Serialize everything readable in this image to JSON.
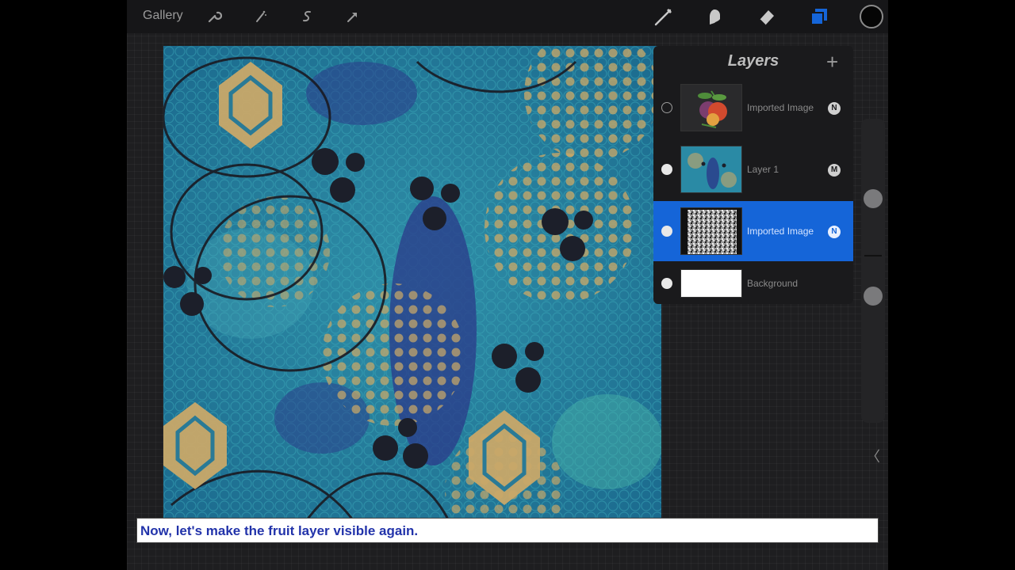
{
  "toolbar": {
    "gallery_label": "Gallery",
    "left_tools": [
      "wrench-icon",
      "magic-wand-icon",
      "selection-icon",
      "transform-icon"
    ],
    "right_tools": [
      "brush-icon",
      "smudge-icon",
      "eraser-icon",
      "layers-icon"
    ],
    "active_tool": "layers-icon",
    "accent_color": "#1565d8",
    "current_color": "#050505"
  },
  "layers_panel": {
    "title": "Layers",
    "add_label": "+",
    "layers": [
      {
        "name": "Imported Image",
        "visible": false,
        "selected": false,
        "blend": "N",
        "thumb": "fruit"
      },
      {
        "name": "Layer 1",
        "visible": true,
        "selected": false,
        "blend": "M",
        "thumb": "texture"
      },
      {
        "name": "Imported Image",
        "visible": true,
        "selected": true,
        "blend": "N",
        "thumb": "noise"
      },
      {
        "name": "Background",
        "visible": true,
        "selected": false,
        "blend": "",
        "thumb": "white"
      }
    ]
  },
  "sidebar": {
    "back_label": "〈"
  },
  "caption": {
    "text": "Now, let's make the fruit layer visible again."
  }
}
